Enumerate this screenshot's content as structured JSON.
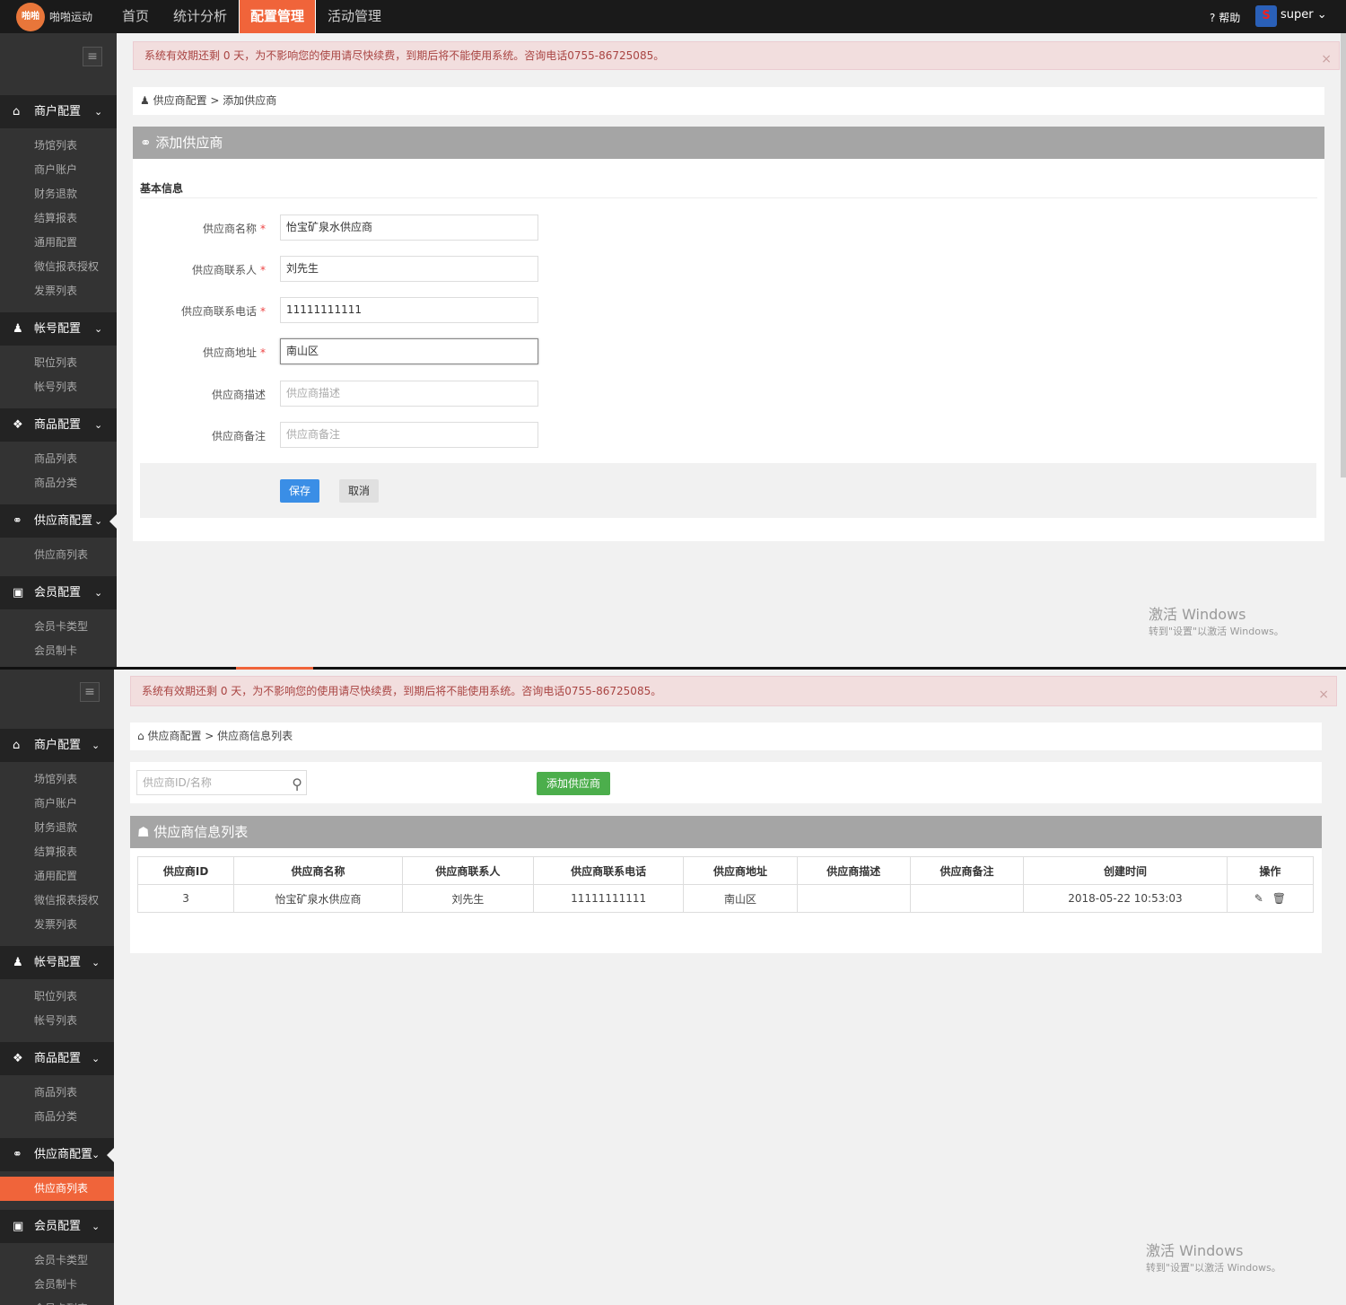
{
  "app": {
    "brand": "啪啪运动",
    "logo": "啪啪",
    "nav": [
      "首页",
      "统计分析",
      "配置管理",
      "活动管理"
    ],
    "active_nav": "配置管理",
    "help": "帮助",
    "user": "super"
  },
  "sidebar": {
    "groups": [
      {
        "label": "商户配置",
        "icon": "home-icon",
        "items": [
          "场馆列表",
          "商户账户",
          "财务退款",
          "结算报表",
          "通用配置",
          "微信报表授权",
          "发票列表"
        ]
      },
      {
        "label": "帐号配置",
        "icon": "user-icon",
        "items": [
          "职位列表",
          "帐号列表"
        ]
      },
      {
        "label": "商品配置",
        "icon": "gift-icon",
        "items": [
          "商品列表",
          "商品分类"
        ]
      },
      {
        "label": "供应商配置",
        "icon": "link-icon",
        "items": [
          "供应商列表"
        ]
      },
      {
        "label": "会员配置",
        "icon": "card-icon",
        "items": [
          "会员卡类型",
          "会员制卡",
          "会员卡列表"
        ]
      }
    ]
  },
  "alert": "系统有效期还剩 0 天，为不影响您的使用请尽快续费，到期后将不能使用系统。咨询电话0755-86725085。",
  "page1": {
    "breadcrumb": "供应商配置 > 添加供应商",
    "panel_title": "添加供应商",
    "section": "基本信息",
    "fields": [
      {
        "label": "供应商名称",
        "required": true,
        "value": "怡宝矿泉水供应商",
        "placeholder": ""
      },
      {
        "label": "供应商联系人",
        "required": true,
        "value": "刘先生",
        "placeholder": ""
      },
      {
        "label": "供应商联系电话",
        "required": true,
        "value": "11111111111",
        "placeholder": ""
      },
      {
        "label": "供应商地址",
        "required": true,
        "value": "南山区",
        "placeholder": ""
      },
      {
        "label": "供应商描述",
        "required": false,
        "value": "",
        "placeholder": "供应商描述"
      },
      {
        "label": "供应商备注",
        "required": false,
        "value": "",
        "placeholder": "供应商备注"
      }
    ],
    "save": "保存",
    "cancel": "取消"
  },
  "page2": {
    "breadcrumb": "供应商配置 > 供应商信息列表",
    "search_placeholder": "供应商ID/名称",
    "add_button": "添加供应商",
    "panel_title": "供应商信息列表",
    "columns": [
      "供应商ID",
      "供应商名称",
      "供应商联系人",
      "供应商联系电话",
      "供应商地址",
      "供应商描述",
      "供应商备注",
      "创建时间",
      "操作"
    ],
    "rows": [
      [
        "3",
        "怡宝矿泉水供应商",
        "刘先生",
        "11111111111",
        "南山区",
        "",
        "",
        "2018-05-22 10:53:03"
      ]
    ]
  },
  "watermark": {
    "line1": "激活 Windows",
    "line2": "转到\"设置\"以激活 Windows。"
  },
  "colors": {
    "accent": "#f0643a",
    "primary": "#3a8ee6",
    "success": "#4cae4c",
    "sidebar": "#333333"
  }
}
